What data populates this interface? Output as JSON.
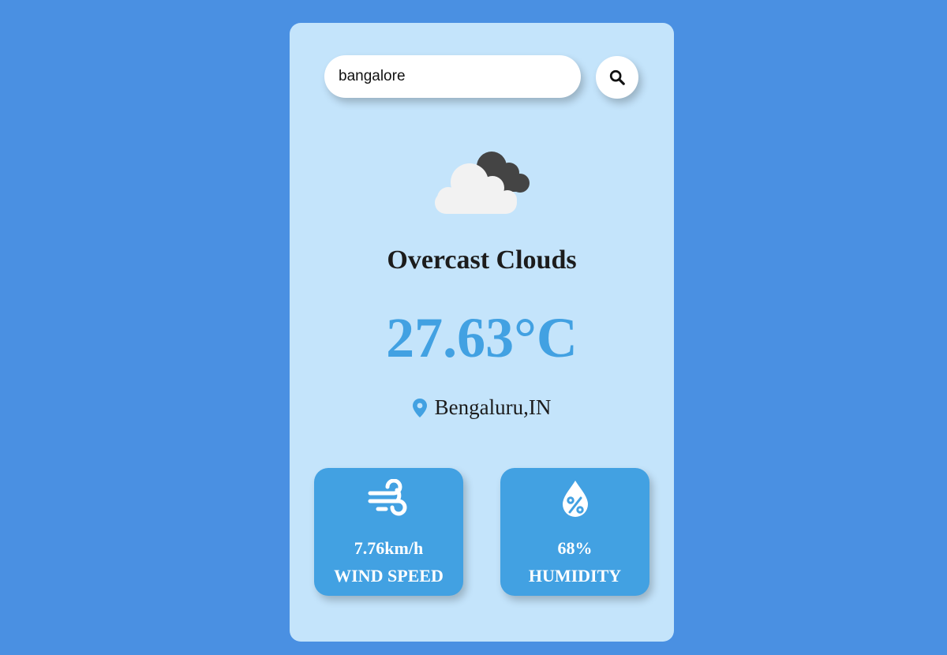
{
  "search": {
    "value": "bangalore",
    "icon": "search-icon"
  },
  "weather": {
    "icon": "overcast-clouds-icon",
    "description": "Overcast Clouds",
    "temperature": "27.63°C",
    "location": "Bengaluru,IN",
    "location_icon": "location-pin-icon"
  },
  "stats": {
    "wind": {
      "icon": "wind-icon",
      "value": "7.76km/h",
      "label": "WIND SPEED"
    },
    "humidity": {
      "icon": "humidity-drop-icon",
      "value": "68%",
      "label": "HUMIDITY"
    }
  },
  "colors": {
    "page_background": "#4a90e2",
    "card_background": "#c4e4fb",
    "accent": "#42a1e2",
    "text_dark": "#1c1c1c"
  }
}
